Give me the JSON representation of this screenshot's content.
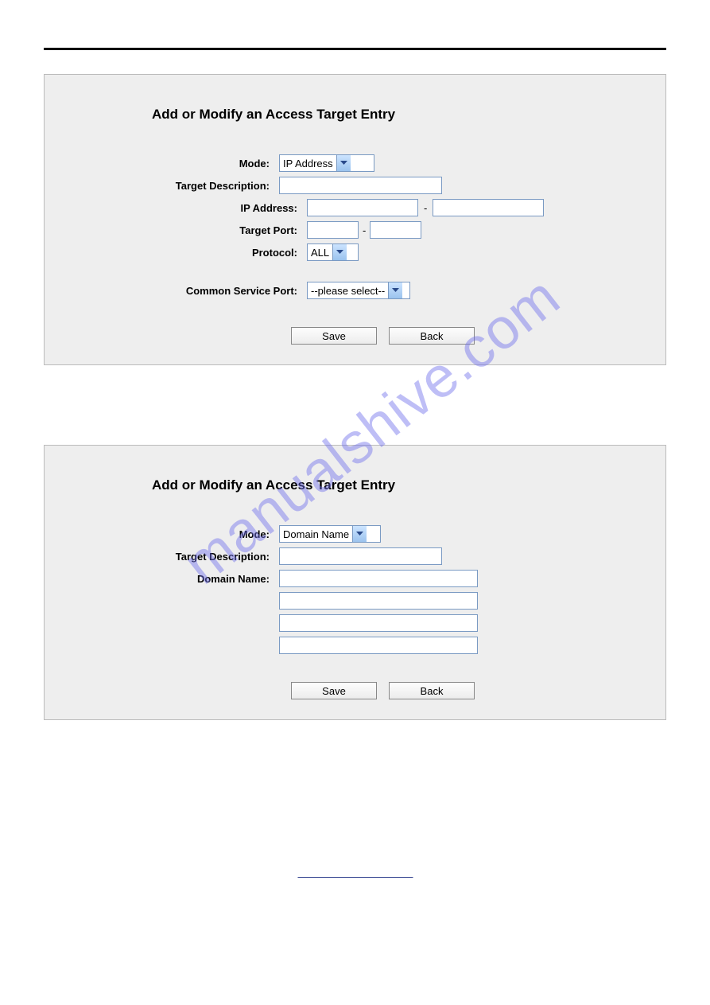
{
  "watermark": "manualshive.com",
  "panel1": {
    "title": "Add or Modify an Access Target Entry",
    "labels": {
      "mode": "Mode:",
      "target_description": "Target Description:",
      "ip_address": "IP Address:",
      "target_port": "Target Port:",
      "protocol": "Protocol:",
      "common_service_port": "Common Service Port:"
    },
    "values": {
      "mode": "IP Address",
      "protocol": "ALL",
      "common_service_port": "--please select--",
      "dash": "-"
    },
    "buttons": {
      "save": "Save",
      "back": "Back"
    }
  },
  "panel2": {
    "title": "Add or Modify an Access Target Entry",
    "labels": {
      "mode": "Mode:",
      "target_description": "Target Description:",
      "domain_name": "Domain Name:"
    },
    "values": {
      "mode": "Domain Name"
    },
    "buttons": {
      "save": "Save",
      "back": "Back"
    }
  }
}
